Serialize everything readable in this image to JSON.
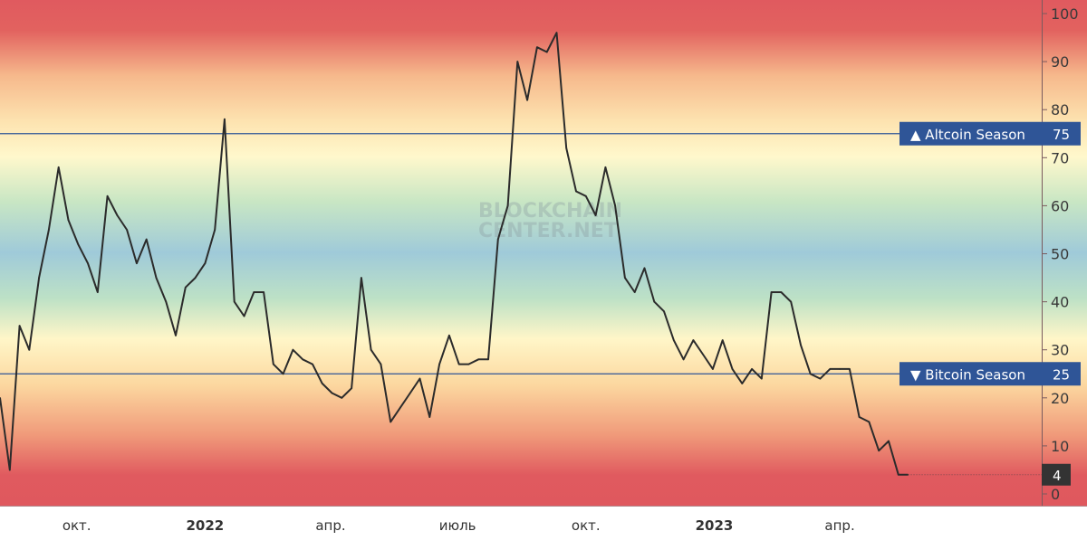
{
  "chart_data": {
    "type": "line",
    "title": "",
    "xlabel": "",
    "ylabel": "",
    "ylim": [
      0,
      100
    ],
    "yticks": [
      0,
      10,
      20,
      30,
      40,
      50,
      60,
      70,
      80,
      90,
      100
    ],
    "xticks": [
      {
        "date": "2021-10-01",
        "label": "окт.",
        "year": false
      },
      {
        "date": "2022-01-01",
        "label": "2022",
        "year": true
      },
      {
        "date": "2022-04-01",
        "label": "апр.",
        "year": false
      },
      {
        "date": "2022-07-01",
        "label": "июль",
        "year": false
      },
      {
        "date": "2022-10-01",
        "label": "окт.",
        "year": false
      },
      {
        "date": "2023-01-01",
        "label": "2023",
        "year": true
      },
      {
        "date": "2023-04-01",
        "label": "апр.",
        "year": false
      }
    ],
    "xlim": [
      "2021-08-07",
      "2023-08-06"
    ],
    "grid": false,
    "line_color": "#2b2b2b",
    "reference_lines": [
      {
        "value": 75,
        "label": "▲ Altcoin Season",
        "value_label": "75",
        "color": "#2f5597"
      },
      {
        "value": 25,
        "label": "▼ Bitcoin Season",
        "value_label": "25",
        "color": "#2f5597"
      }
    ],
    "last_value": {
      "value": 4,
      "label": "4",
      "color": "#333333"
    },
    "watermark": [
      "BLOCKCHAIN",
      "CENTER.NET"
    ],
    "dates": [
      "2021-08-07",
      "2021-08-14",
      "2021-08-21",
      "2021-08-28",
      "2021-09-04",
      "2021-09-11",
      "2021-09-18",
      "2021-09-25",
      "2021-10-02",
      "2021-10-09",
      "2021-10-16",
      "2021-10-23",
      "2021-10-30",
      "2021-11-06",
      "2021-11-13",
      "2021-11-20",
      "2021-11-27",
      "2021-12-04",
      "2021-12-11",
      "2021-12-18",
      "2021-12-25",
      "2022-01-01",
      "2022-01-08",
      "2022-01-15",
      "2022-01-22",
      "2022-01-29",
      "2022-02-05",
      "2022-02-12",
      "2022-02-19",
      "2022-02-26",
      "2022-03-05",
      "2022-03-12",
      "2022-03-19",
      "2022-03-26",
      "2022-04-02",
      "2022-04-09",
      "2022-04-16",
      "2022-04-23",
      "2022-04-30",
      "2022-05-07",
      "2022-05-14",
      "2022-05-21",
      "2022-05-28",
      "2022-06-04",
      "2022-06-11",
      "2022-06-18",
      "2022-06-25",
      "2022-07-02",
      "2022-07-09",
      "2022-07-16",
      "2022-07-23",
      "2022-07-30",
      "2022-08-06",
      "2022-08-13",
      "2022-08-20",
      "2022-08-27",
      "2022-09-03",
      "2022-09-10",
      "2022-09-17",
      "2022-09-24",
      "2022-10-01",
      "2022-10-08",
      "2022-10-15",
      "2022-10-22",
      "2022-10-29",
      "2022-11-05",
      "2022-11-12",
      "2022-11-19",
      "2022-11-26",
      "2022-12-03",
      "2022-12-10",
      "2022-12-17",
      "2022-12-24",
      "2022-12-31",
      "2023-01-07",
      "2023-01-14",
      "2023-01-21",
      "2023-01-28",
      "2023-02-04",
      "2023-02-11",
      "2023-02-18",
      "2023-02-25",
      "2023-03-04",
      "2023-03-11",
      "2023-03-18",
      "2023-03-25",
      "2023-04-01",
      "2023-04-08",
      "2023-04-15",
      "2023-04-22",
      "2023-04-29",
      "2023-05-06",
      "2023-05-13",
      "2023-05-20"
    ],
    "values": [
      20,
      5,
      35,
      30,
      45,
      55,
      68,
      57,
      52,
      48,
      42,
      62,
      58,
      55,
      48,
      53,
      45,
      40,
      33,
      43,
      45,
      48,
      55,
      78,
      40,
      37,
      42,
      42,
      27,
      25,
      30,
      28,
      27,
      23,
      21,
      20,
      22,
      45,
      30,
      27,
      15,
      18,
      21,
      24,
      16,
      27,
      33,
      27,
      27,
      28,
      28,
      53,
      60,
      90,
      82,
      93,
      92,
      96,
      72,
      63,
      62,
      58,
      68,
      60,
      45,
      42,
      47,
      40,
      38,
      32,
      28,
      32,
      29,
      26,
      32,
      26,
      23,
      26,
      24,
      42,
      42,
      40,
      31,
      25,
      24,
      26,
      26,
      26,
      16,
      15,
      9,
      11,
      4,
      4
    ]
  }
}
